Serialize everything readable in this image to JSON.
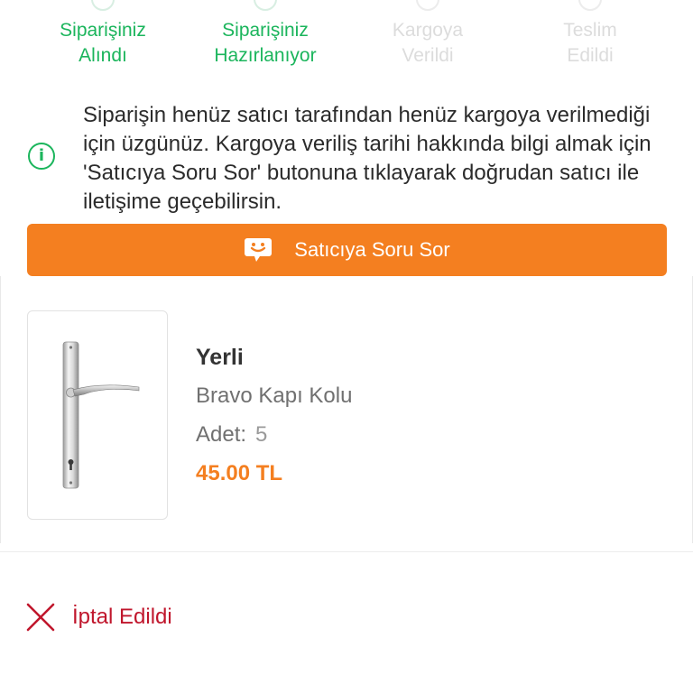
{
  "stepper": {
    "steps": [
      {
        "line1": "Siparişiniz",
        "line2": "Alındı",
        "state": "active"
      },
      {
        "line1": "Siparişiniz",
        "line2": "Hazırlanıyor",
        "state": "active"
      },
      {
        "line1": "Kargoya",
        "line2": "Verildi",
        "state": "inactive"
      },
      {
        "line1": "Teslim",
        "line2": "Edildi",
        "state": "inactive"
      }
    ]
  },
  "info": {
    "icon": "info-icon",
    "icon_glyph": "i",
    "message": "Siparişin henüz satıcı tarafından henüz kargoya verilmediği için üzgünüz. Kargoya veriliş tarihi hakkında bilgi almak için 'Satıcıya Soru Sor' butonuna tıklayarak doğrudan satıcı ile iletişime geçebilirsin."
  },
  "ask_seller": {
    "label": "Satıcıya Soru Sor",
    "icon": "chat-smile-icon",
    "color": "#f47f20"
  },
  "product": {
    "image_icon": "door-handle-image",
    "brand": "Yerli",
    "name": "Bravo Kapı Kolu",
    "quantity_label": "Adet:",
    "quantity_value": "5",
    "price": "45.00 TL"
  },
  "status": {
    "icon": "close-x-icon",
    "text": "İptal Edildi",
    "color": "#c0162c"
  },
  "colors": {
    "accent_green": "#1bb55c",
    "accent_orange": "#f47f20",
    "cancel_red": "#c0162c"
  }
}
